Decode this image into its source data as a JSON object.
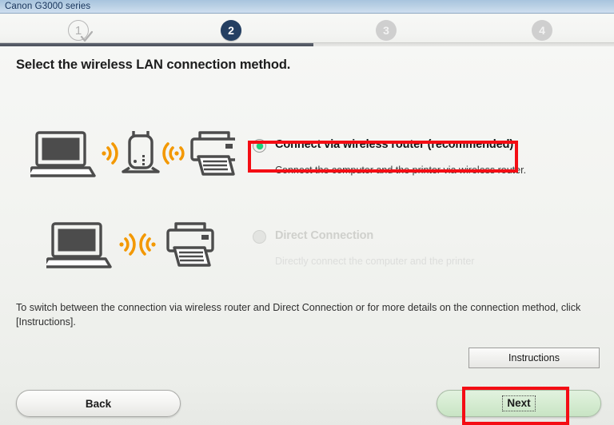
{
  "window": {
    "title": "Canon G3000 series"
  },
  "stepper": {
    "steps": [
      {
        "number": "1",
        "state": "completed",
        "icon": "check-icon"
      },
      {
        "number": "2",
        "state": "active"
      },
      {
        "number": "3",
        "state": "pending"
      },
      {
        "number": "4",
        "state": "pending"
      }
    ],
    "progress_percent": 51,
    "active_color": "#243f62",
    "pending_color": "#cfcfcf"
  },
  "main": {
    "heading": "Select the wireless LAN connection method.",
    "options": [
      {
        "id": "wireless-router",
        "label": "Connect via wireless router (recommended)",
        "description": "Connect the computer and the printer via wireless router.",
        "selected": true,
        "enabled": true,
        "illustration": [
          "laptop-icon",
          "wifi-waves-icon",
          "router-icon",
          "wifi-waves-icon",
          "printer-icon"
        ]
      },
      {
        "id": "direct-connection",
        "label": "Direct Connection",
        "description": "Directly connect the computer and the printer",
        "selected": false,
        "enabled": false,
        "illustration": [
          "laptop-icon",
          "wifi-waves-icon",
          "wifi-waves-icon",
          "printer-icon"
        ]
      }
    ],
    "note": "To switch between the connection via wireless router and Direct Connection or for more details on the connection method, click [Instructions].",
    "instructions_label": "Instructions"
  },
  "footer": {
    "back_label": "Back",
    "next_label": "Next"
  },
  "highlights": {
    "color": "#f40d14",
    "targets": [
      "wireless-router-option",
      "next-button"
    ]
  }
}
